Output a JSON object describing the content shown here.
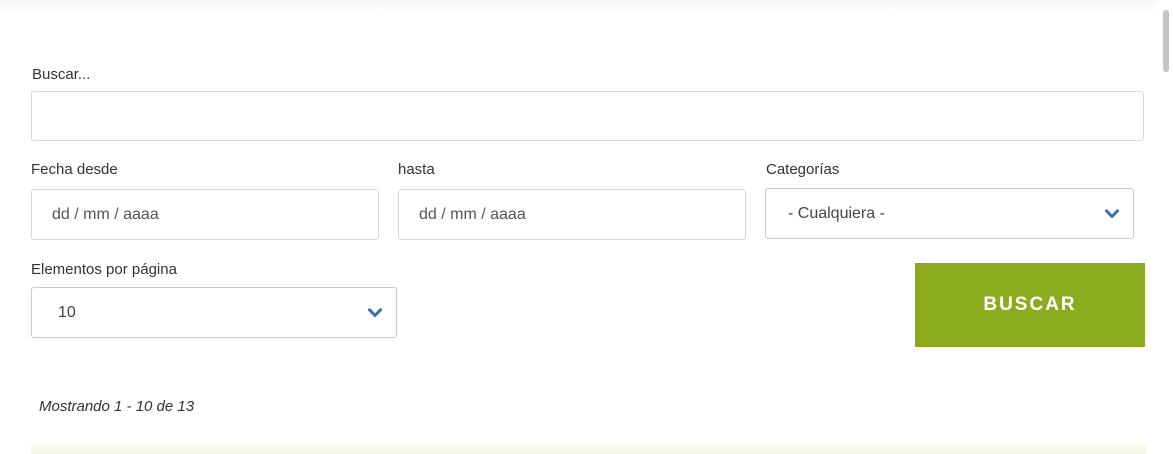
{
  "search": {
    "label": "Buscar...",
    "value": ""
  },
  "date_from": {
    "label": "Fecha desde",
    "placeholder": "dd / mm / aaaa"
  },
  "date_to": {
    "label": "hasta",
    "placeholder": "dd / mm / aaaa"
  },
  "categories": {
    "label": "Categorías",
    "selected": "- Cualquiera -"
  },
  "per_page": {
    "label": "Elementos por página",
    "selected": "10"
  },
  "submit": {
    "label": "BUSCAR"
  },
  "results": {
    "summary": "Mostrando 1 - 10 de 13"
  },
  "colors": {
    "button": "#8dab1e",
    "chevron": "#3a6fb0"
  },
  "icons": {
    "dropdown": "chevron-down-icon"
  }
}
